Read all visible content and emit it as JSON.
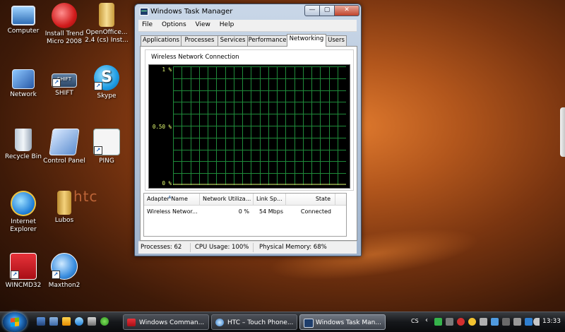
{
  "desktop": {
    "icons": [
      {
        "label": "Computer"
      },
      {
        "label": "Install Trend Micro 2008"
      },
      {
        "label": "OpenOffice... 2.4 (cs) Inst..."
      },
      {
        "label": "Network"
      },
      {
        "label": "SHIFT",
        "badge": "SHIFT"
      },
      {
        "label": "Skype"
      },
      {
        "label": "Recycle Bin"
      },
      {
        "label": "Control Panel"
      },
      {
        "label": "PING"
      },
      {
        "label": "Internet Explorer"
      },
      {
        "label": "Lubos"
      },
      {
        "label": "WINCMD32"
      },
      {
        "label": "Maxthon2"
      }
    ],
    "wallpaper_logo": "htc"
  },
  "window": {
    "title": "Windows Task Manager",
    "controls": {
      "minimize": "—",
      "maximize": "▢",
      "close": "✕"
    },
    "menu": [
      "File",
      "Options",
      "View",
      "Help"
    ],
    "tabs": [
      "Applications",
      "Processes",
      "Services",
      "Performance",
      "Networking",
      "Users"
    ],
    "active_tab": "Networking",
    "graph": {
      "title": "Wireless Network Connection",
      "y_labels": [
        "1 %",
        "0.50 %",
        "0 %"
      ],
      "grid_color": "#1f8a3a",
      "line_color": "#e6ff73"
    },
    "list": {
      "columns": [
        "Adapter Name",
        "Network Utiliza...",
        "Link Sp...",
        "State"
      ],
      "rows": [
        {
          "adapter": "Wireless Networ...",
          "utilization": "0 %",
          "link_speed": "54 Mbps",
          "state": "Connected"
        }
      ]
    },
    "status": {
      "processes": "Processes: 62",
      "cpu": "CPU Usage: 100%",
      "memory": "Physical Memory: 68%"
    }
  },
  "taskbar": {
    "buttons": [
      {
        "label": "Windows Comman..."
      },
      {
        "label": "HTC – Touch Phone..."
      },
      {
        "label": "Windows Task Man..."
      }
    ],
    "language": "CS",
    "tray_chevron": "‹",
    "clock": "13:33"
  }
}
